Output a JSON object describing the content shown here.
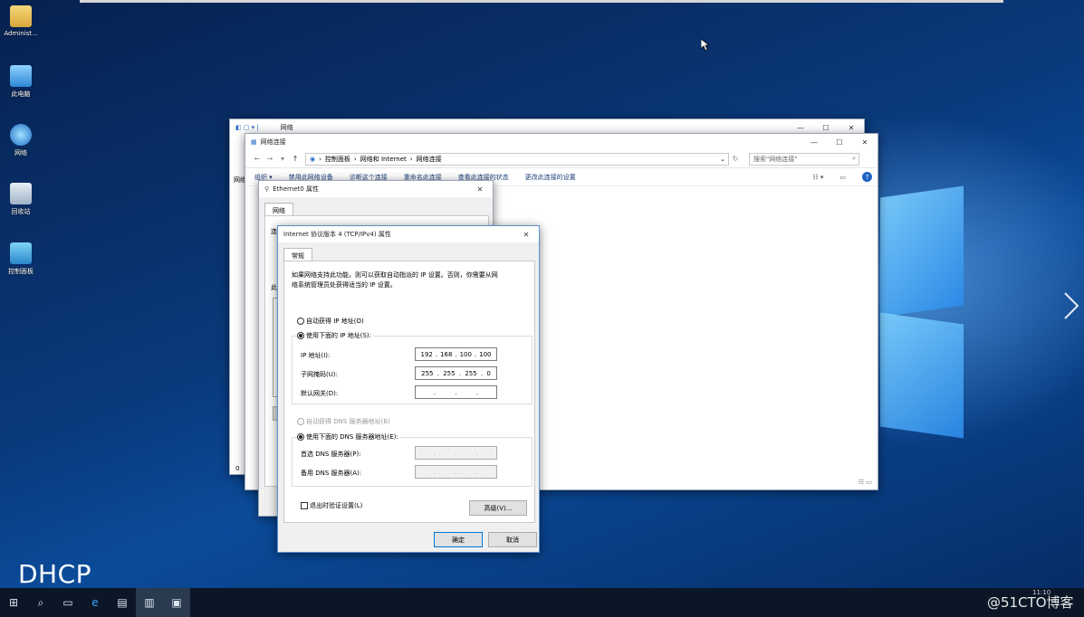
{
  "desktop": {
    "icons": [
      {
        "label": "Administ..."
      },
      {
        "label": "此电脑"
      },
      {
        "label": "网络"
      },
      {
        "label": "回收站"
      },
      {
        "label": "控制面板"
      }
    ]
  },
  "overlay": {
    "dhcp": "DHCP",
    "watermark": "@51CTO博客",
    "clock": "11:10"
  },
  "explorer_back": {
    "title": "网络"
  },
  "explorer": {
    "title": "网络连接",
    "breadcrumb": [
      "控制面板",
      "网络和 Internet",
      "网络连接"
    ],
    "search_placeholder": "搜索\"网络连接\"",
    "commands": [
      "组织 ▾",
      "禁用此网络设备",
      "诊断这个连接",
      "重命名此连接",
      "查看此连接的状态",
      "更改此连接的设置"
    ],
    "left_stub_top": "网络",
    "left_stub_bottom": "0"
  },
  "ethernet": {
    "title": "Ethernet0 属性",
    "tab": "网络",
    "stub_labels": [
      "连",
      "此"
    ]
  },
  "tcp": {
    "title": "Internet 协议版本 4 (TCP/IPv4) 属性",
    "tab": "常规",
    "description": [
      "如果网络支持此功能，则可以获取自动指派的 IP 设置。否则，你需要从网",
      "络系统管理员处获得适当的 IP 设置。"
    ],
    "auto_ip": "自动获得 IP 地址(O)",
    "manual_ip": "使用下面的 IP 地址(S):",
    "ip_label": "IP 地址(I):",
    "ip_value": [
      "192",
      "168",
      "100",
      "100"
    ],
    "mask_label": "子网掩码(U):",
    "mask_value": [
      "255",
      "255",
      "255",
      "0"
    ],
    "gateway_label": "默认网关(D):",
    "auto_dns": "自动获得 DNS 服务器地址(B)",
    "manual_dns": "使用下面的 DNS 服务器地址(E):",
    "dns1_label": "首选 DNS 服务器(P):",
    "dns2_label": "备用 DNS 服务器(A):",
    "validate": "退出时验证设置(L)",
    "advanced": "高级(V)...",
    "ok": "确定",
    "cancel": "取消",
    "close": "✕"
  },
  "window_controls": {
    "minimize": "—",
    "maximize": "☐",
    "close": "✕"
  }
}
